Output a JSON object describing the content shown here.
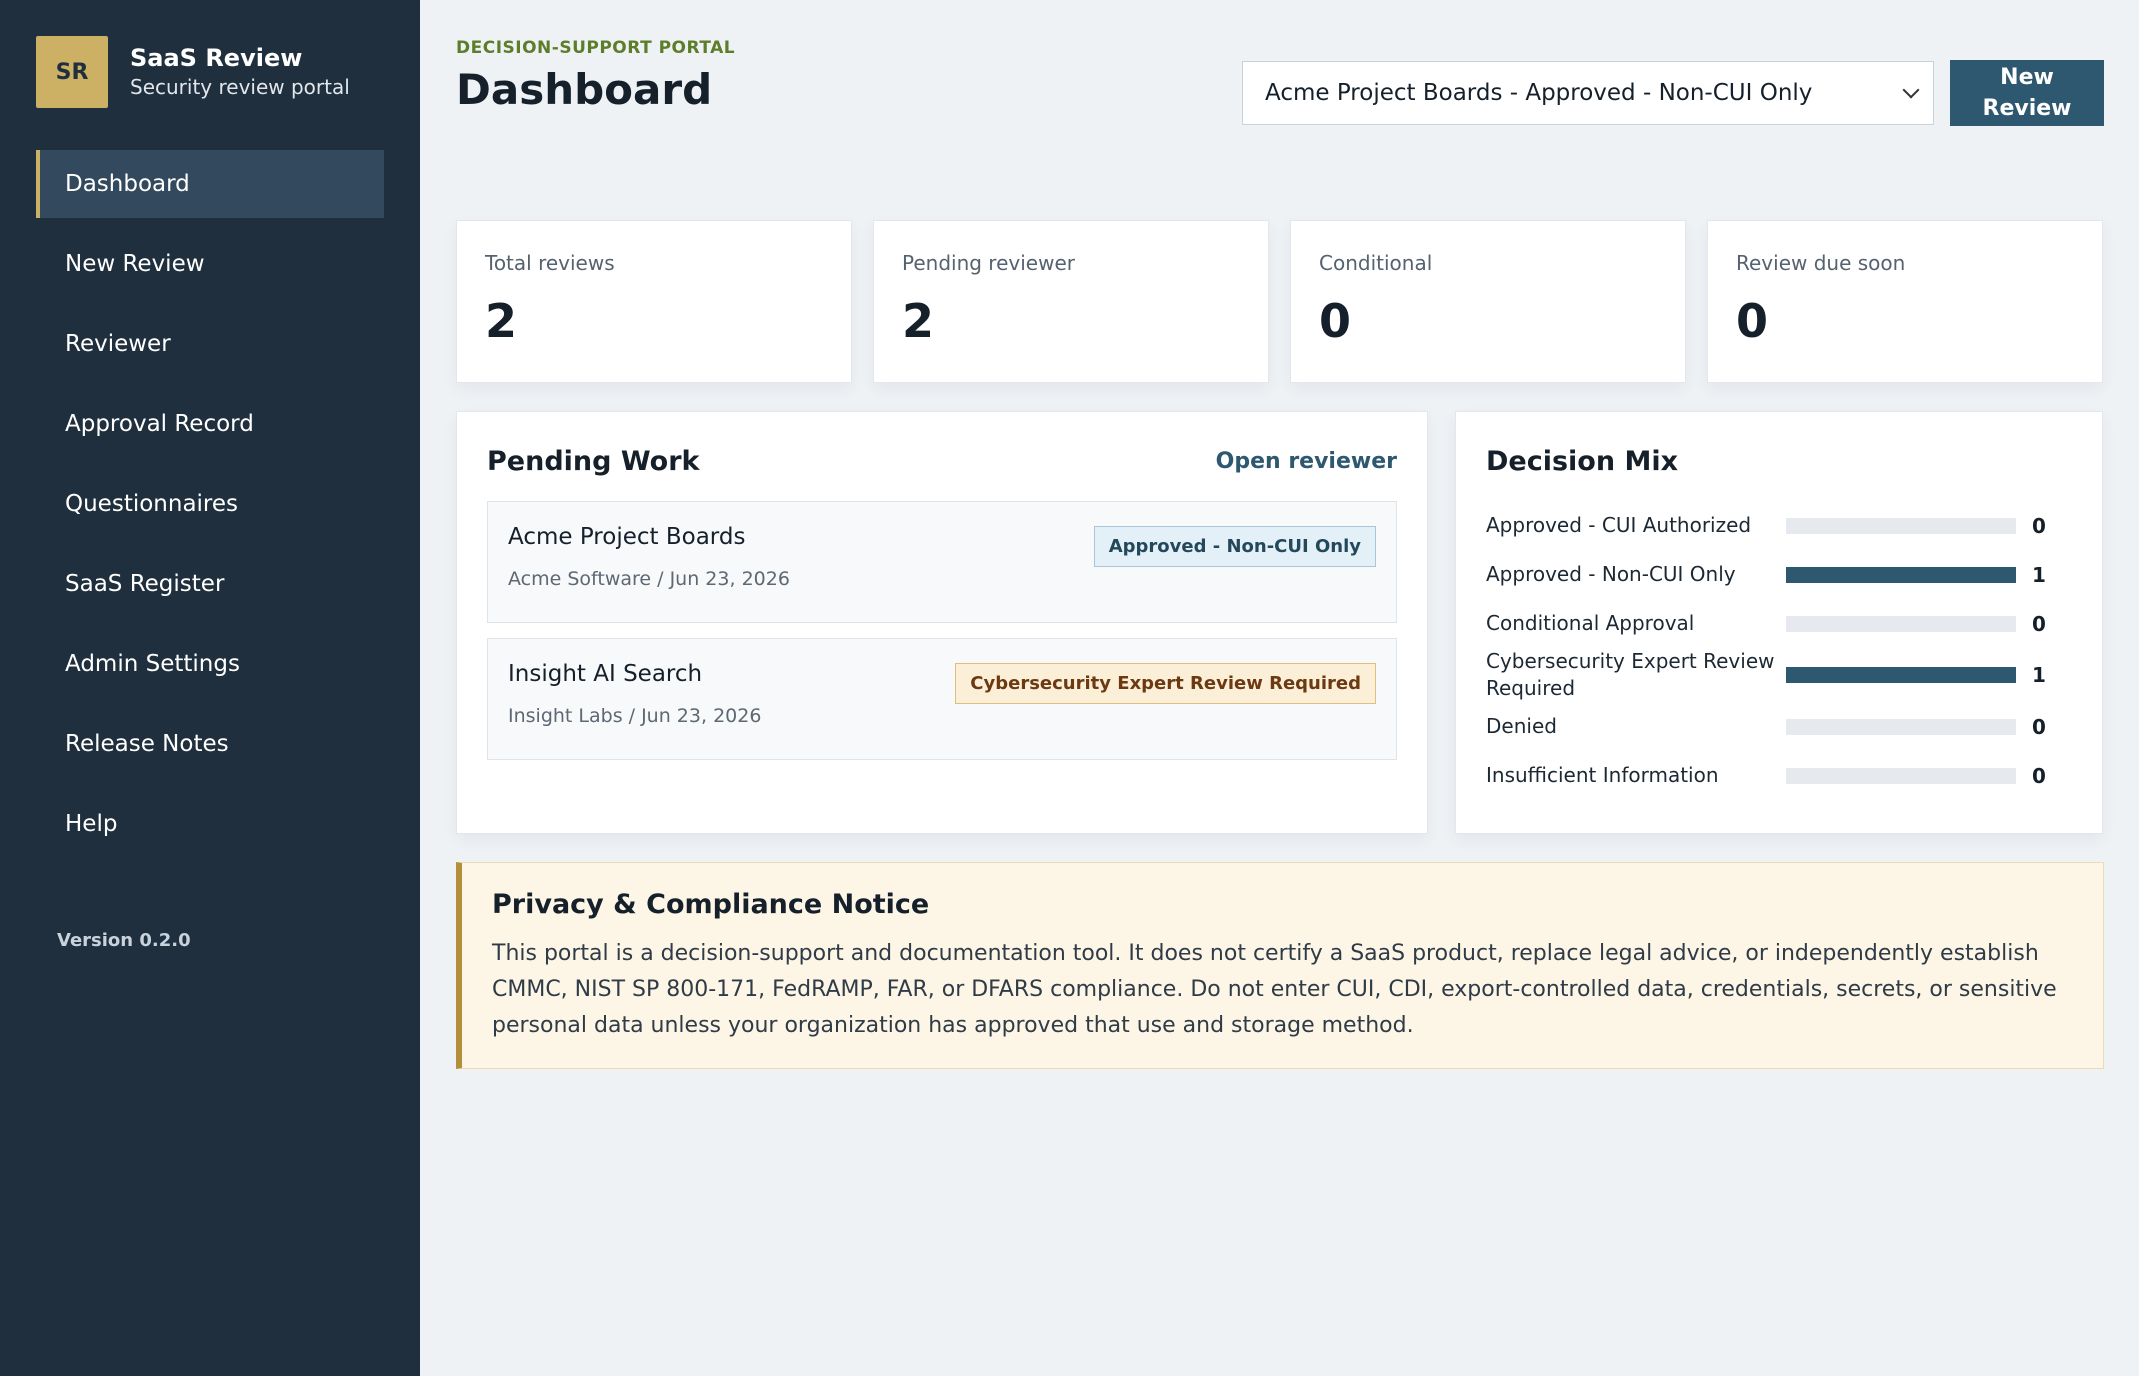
{
  "brand": {
    "initials": "SR",
    "title": "SaaS Review",
    "subtitle": "Security review portal"
  },
  "nav": [
    {
      "label": "Dashboard",
      "active": true
    },
    {
      "label": "New Review"
    },
    {
      "label": "Reviewer"
    },
    {
      "label": "Approval Record"
    },
    {
      "label": "Questionnaires"
    },
    {
      "label": "SaaS Register"
    },
    {
      "label": "Admin Settings"
    },
    {
      "label": "Release Notes"
    },
    {
      "label": "Help"
    }
  ],
  "version": "Version 0.2.0",
  "header": {
    "eyebrow": "DECISION-SUPPORT PORTAL",
    "title": "Dashboard",
    "select_value": "Acme Project Boards - Approved - Non-CUI Only",
    "new_review_label": "New Review"
  },
  "stats": [
    {
      "label": "Total reviews",
      "value": "2"
    },
    {
      "label": "Pending reviewer",
      "value": "2"
    },
    {
      "label": "Conditional",
      "value": "0"
    },
    {
      "label": "Review due soon",
      "value": "0"
    }
  ],
  "pending": {
    "title": "Pending Work",
    "link": "Open reviewer",
    "items": [
      {
        "name": "Acme Project Boards",
        "meta": "Acme Software / Jun 23, 2026",
        "badge": "Approved - Non-CUI Only",
        "badge_color": "#e4f0f7"
      },
      {
        "name": "Insight AI Search",
        "meta": "Insight Labs / Jun 23, 2026",
        "badge": "Cybersecurity Expert Review Required",
        "badge_color": "#fbefd8"
      }
    ]
  },
  "mix": {
    "title": "Decision Mix",
    "bar_color": "#2e5870",
    "max": 1,
    "items": [
      {
        "label": "Approved - CUI Authorized",
        "count": 0
      },
      {
        "label": "Approved - Non-CUI Only",
        "count": 1
      },
      {
        "label": "Conditional Approval",
        "count": 0
      },
      {
        "label": "Cybersecurity Expert Review Required",
        "count": 1
      },
      {
        "label": "Denied",
        "count": 0
      },
      {
        "label": "Insufficient Information",
        "count": 0
      }
    ]
  },
  "notice": {
    "title": "Privacy & Compliance Notice",
    "body": "This portal is a decision-support and documentation tool. It does not certify a SaaS product, replace legal advice, or independently establish CMMC, NIST SP 800-171, FedRAMP, FAR, or DFARS compliance. Do not enter CUI, CDI, export-controlled data, credentials, secrets, or sensitive personal data unless your organization has approved that use and storage method."
  }
}
